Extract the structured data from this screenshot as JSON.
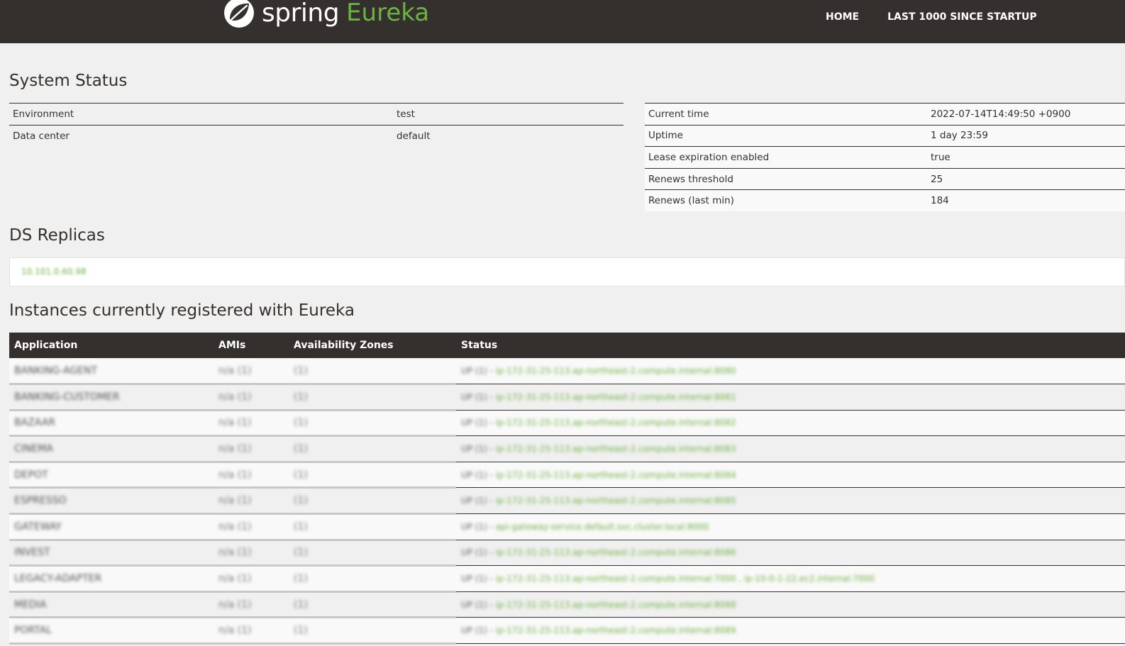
{
  "header": {
    "logo_spring": "spring",
    "logo_eureka": "Eureka",
    "nav": [
      "HOME",
      "LAST 1000 SINCE STARTUP"
    ]
  },
  "system_status": {
    "title": "System Status",
    "left": [
      {
        "key": "Environment",
        "value": "test"
      },
      {
        "key": "Data center",
        "value": "default"
      }
    ],
    "right": [
      {
        "key": "Current time",
        "value": "2022-07-14T14:49:50 +0900"
      },
      {
        "key": "Uptime",
        "value": "1 day 23:59"
      },
      {
        "key": "Lease expiration enabled",
        "value": "true"
      },
      {
        "key": "Renews threshold",
        "value": "25"
      },
      {
        "key": "Renews (last min)",
        "value": "184"
      }
    ]
  },
  "ds_replicas": {
    "title": "DS Replicas",
    "link": "10.101.0.60.98"
  },
  "instances": {
    "title": "Instances currently registered with Eureka",
    "columns": [
      "Application",
      "AMIs",
      "Availability Zones",
      "Status"
    ],
    "rows": [
      {
        "app": "BANKING-AGENT",
        "ami": "n/a (1)",
        "zone": "(1)",
        "status": "UP (1) -",
        "link": "ip-172-31-25-113.ap-northeast-2.compute.internal:8080"
      },
      {
        "app": "BANKING-CUSTOMER",
        "ami": "n/a (1)",
        "zone": "(1)",
        "status": "UP (1) -",
        "link": "ip-172-31-25-113.ap-northeast-2.compute.internal:8081"
      },
      {
        "app": "BAZAAR",
        "ami": "n/a (1)",
        "zone": "(1)",
        "status": "UP (1) -",
        "link": "ip-172-31-25-113.ap-northeast-2.compute.internal:8082"
      },
      {
        "app": "CINEMA",
        "ami": "n/a (1)",
        "zone": "(1)",
        "status": "UP (1) -",
        "link": "ip-172-31-25-113.ap-northeast-2.compute.internal:8083"
      },
      {
        "app": "DEPOT",
        "ami": "n/a (1)",
        "zone": "(1)",
        "status": "UP (1) -",
        "link": "ip-172-31-25-113.ap-northeast-2.compute.internal:8084"
      },
      {
        "app": "ESPRESSO",
        "ami": "n/a (1)",
        "zone": "(1)",
        "status": "UP (1) -",
        "link": "ip-172-31-25-113.ap-northeast-2.compute.internal:8085"
      },
      {
        "app": "GATEWAY",
        "ami": "n/a (1)",
        "zone": "(1)",
        "status": "UP (1) -",
        "link": "api-gateway-service.default.svc.cluster.local:8000"
      },
      {
        "app": "INVEST",
        "ami": "n/a (1)",
        "zone": "(1)",
        "status": "UP (1) -",
        "link": "ip-172-31-25-113.ap-northeast-2.compute.internal:8086"
      },
      {
        "app": "LEGACY-ADAPTER",
        "ami": "n/a (1)",
        "zone": "(1)",
        "status": "UP (1) -",
        "link": "ip-172-31-25-113.ap-northeast-2.compute.internal:7000 , ip-10-0-1-22.ec2.internal:7000"
      },
      {
        "app": "MEDIA",
        "ami": "n/a (1)",
        "zone": "(1)",
        "status": "UP (1) -",
        "link": "ip-172-31-25-113.ap-northeast-2.compute.internal:8088"
      },
      {
        "app": "PORTAL",
        "ami": "n/a (1)",
        "zone": "(1)",
        "status": "UP (1) -",
        "link": "ip-172-31-25-113.ap-northeast-2.compute.internal:8089"
      }
    ]
  }
}
